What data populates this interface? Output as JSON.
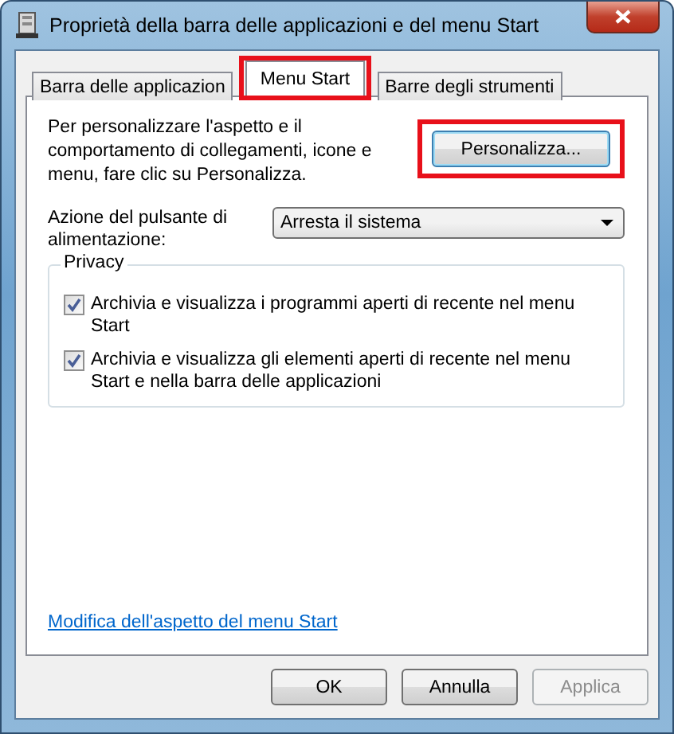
{
  "window": {
    "title": "Proprietà della barra delle applicazioni e del menu Start"
  },
  "tabs": [
    {
      "label": "Barra delle applicazion",
      "selected": false,
      "highlighted": false
    },
    {
      "label": "Menu Start",
      "selected": true,
      "highlighted": true
    },
    {
      "label": "Barre degli strumenti",
      "selected": false,
      "highlighted": false
    }
  ],
  "intro": {
    "text": "Per personalizzare l'aspetto e il comportamento di collegamenti, icone e menu, fare clic su Personalizza.",
    "button": {
      "label": "Personalizza...",
      "highlighted": true
    }
  },
  "power": {
    "label": "Azione del pulsante di alimentazione:",
    "value": "Arresta il sistema"
  },
  "privacy": {
    "title": "Privacy",
    "options": [
      {
        "label": "Archivia e visualizza i programmi aperti di recente nel menu Start",
        "checked": true
      },
      {
        "label": "Archivia e visualizza gli elementi aperti di recente nel menu Start e nella barra delle applicazioni",
        "checked": true
      }
    ]
  },
  "link": "Modifica dell'aspetto del menu Start",
  "buttons": [
    {
      "label": "OK",
      "disabled": false
    },
    {
      "label": "Annulla",
      "disabled": false
    },
    {
      "label": "Applica",
      "disabled": true
    }
  ]
}
